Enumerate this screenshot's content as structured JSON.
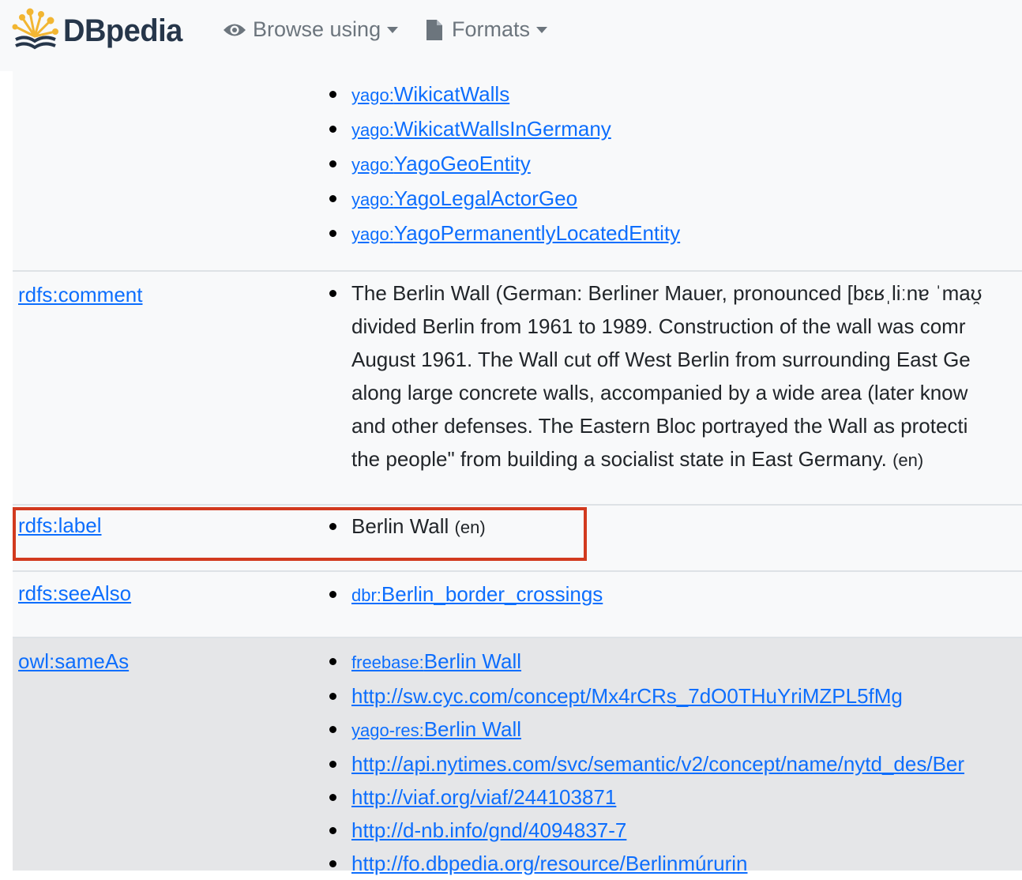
{
  "navbar": {
    "brand": "DBpedia",
    "browse_label": "Browse using",
    "formats_label": "Formats"
  },
  "type_values": [
    {
      "prefix": "yago:",
      "local": "WikicatWalls"
    },
    {
      "prefix": "yago:",
      "local": "WikicatWallsInGermany"
    },
    {
      "prefix": "yago:",
      "local": "YagoGeoEntity"
    },
    {
      "prefix": "yago:",
      "local": "YagoLegalActorGeo"
    },
    {
      "prefix": "yago:",
      "local": "YagoPermanentlyLocatedEntity"
    }
  ],
  "comment": {
    "property": "rdfs:comment",
    "lines": [
      "The Berlin Wall (German: Berliner Mauer, pronounced [bɛʁˌliːnɐ ˈmaʊ̯",
      "divided Berlin from 1961 to 1989. Construction of the wall was comr",
      "August 1961. The Wall cut off West Berlin from surrounding East Ge",
      "along large concrete walls, accompanied by a wide area (later know",
      "and other defenses. The Eastern Bloc portrayed the Wall as protecti",
      "the people\" from building a socialist state in East Germany."
    ],
    "lang": "(en)"
  },
  "label": {
    "property": "rdfs:label",
    "value": "Berlin Wall",
    "lang": "(en)"
  },
  "see_also": {
    "property": "rdfs:seeAlso",
    "prefix": "dbr:",
    "local": "Berlin_border_crossings"
  },
  "same_as": {
    "property": "owl:sameAs",
    "values": [
      {
        "prefix": "freebase:",
        "local": "Berlin Wall"
      },
      {
        "prefix": "",
        "local": "http://sw.cyc.com/concept/Mx4rCRs_7dO0THuYriMZPL5fMg"
      },
      {
        "prefix": "yago-res:",
        "local": "Berlin Wall"
      },
      {
        "prefix": "",
        "local": "http://api.nytimes.com/svc/semantic/v2/concept/name/nytd_des/Ber"
      },
      {
        "prefix": "",
        "local": "http://viaf.org/viaf/244103871"
      },
      {
        "prefix": "",
        "local": "http://d-nb.info/gnd/4094837-7"
      },
      {
        "prefix": "",
        "local": "http://fo.dbpedia.org/resource/Berlinmúrurin"
      }
    ]
  },
  "colors": {
    "link": "#0d6efd",
    "highlight_border": "#d23a1f",
    "brand_text": "#26364a",
    "brand_logo": "#f2b632"
  }
}
